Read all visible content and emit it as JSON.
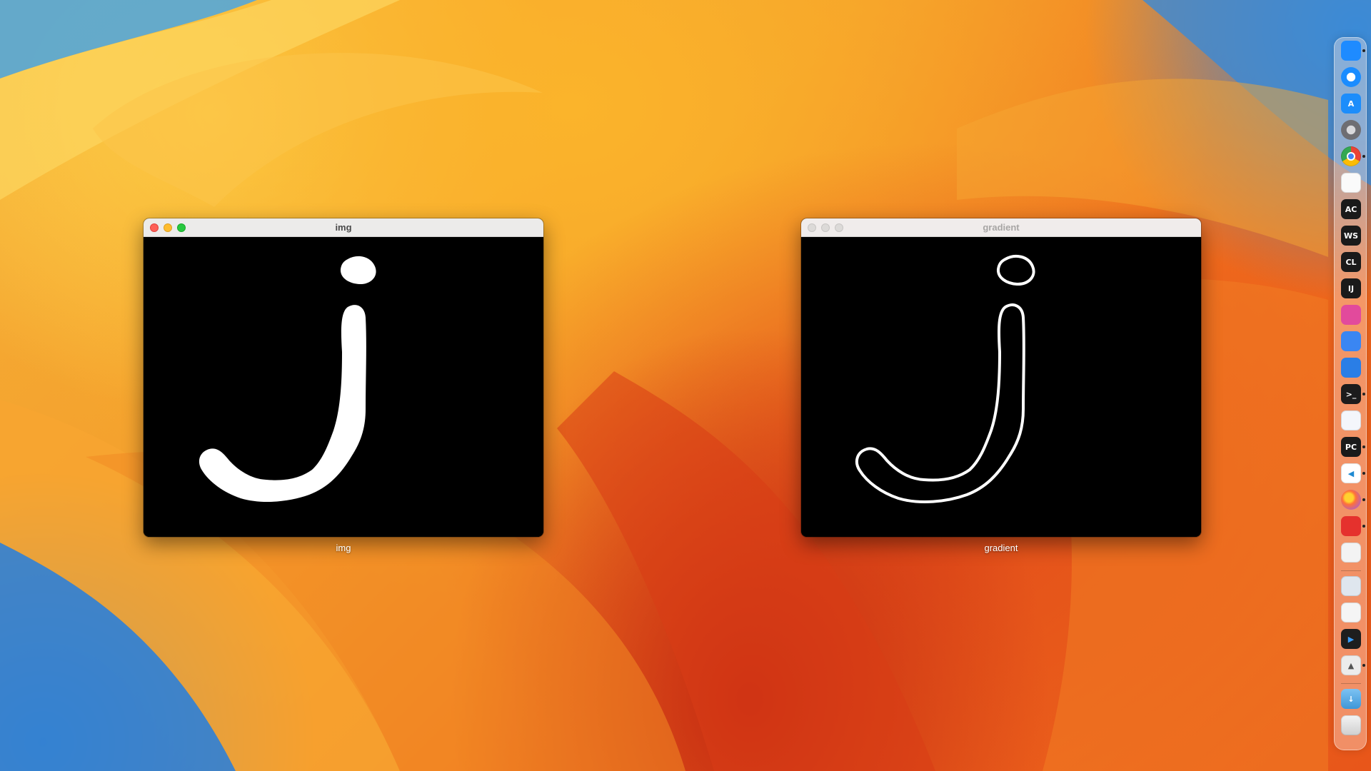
{
  "windows": [
    {
      "id": "img",
      "title": "img",
      "label": "img",
      "active": true
    },
    {
      "id": "gradient",
      "title": "gradient",
      "label": "gradient",
      "active": false
    }
  ],
  "dock": {
    "items": [
      {
        "name": "finder",
        "icon": "finder-icon",
        "color": "#1e8bff",
        "glyph": "",
        "running": true
      },
      {
        "name": "safari",
        "icon": "safari-icon",
        "color": "#1a8cff",
        "glyph": "",
        "running": false
      },
      {
        "name": "app-store",
        "icon": "app-store-icon",
        "color": "#1c8dfb",
        "glyph": "A",
        "running": false
      },
      {
        "name": "system-settings",
        "icon": "gear-icon",
        "color": "#8e8e93",
        "glyph": "",
        "running": false
      },
      {
        "name": "chrome",
        "icon": "chrome-icon",
        "color": "#ffffff",
        "glyph": "",
        "running": true
      },
      {
        "name": "notes",
        "icon": "notes-icon",
        "color": "#fafafa",
        "glyph": "",
        "running": false
      },
      {
        "name": "appcode",
        "icon": "appcode-icon",
        "color": "#1a1a1a",
        "glyph": "AC",
        "running": false
      },
      {
        "name": "webstorm",
        "icon": "webstorm-icon",
        "color": "#1a1a1a",
        "glyph": "WS",
        "running": false
      },
      {
        "name": "clion",
        "icon": "clion-icon",
        "color": "#1a1a1a",
        "glyph": "CL",
        "running": false
      },
      {
        "name": "intellij",
        "icon": "intellij-icon",
        "color": "#1a1a1a",
        "glyph": "IJ",
        "running": false
      },
      {
        "name": "cleanmymac",
        "icon": "cleanmymac-icon",
        "color": "#e24a9c",
        "glyph": "",
        "running": false
      },
      {
        "name": "xcode",
        "icon": "xcode-icon",
        "color": "#3a86f2",
        "glyph": "",
        "running": false
      },
      {
        "name": "mountain-app",
        "icon": "mountain-icon",
        "color": "#2a7ee6",
        "glyph": "",
        "running": false
      },
      {
        "name": "terminal",
        "icon": "terminal-icon",
        "color": "#1c1c1c",
        "glyph": ">_",
        "running": true
      },
      {
        "name": "1password",
        "icon": "1password-icon",
        "color": "#f4f6fb",
        "glyph": "",
        "running": false
      },
      {
        "name": "pycharm",
        "icon": "pycharm-icon",
        "color": "#1a1a1a",
        "glyph": "PC",
        "running": true
      },
      {
        "name": "vscode",
        "icon": "vscode-icon",
        "color": "#ffffff",
        "glyph": "",
        "running": true
      },
      {
        "name": "firefox",
        "icon": "firefox-icon",
        "color": "#ff7139",
        "glyph": "",
        "running": true
      },
      {
        "name": "screen-recorder",
        "icon": "recorder-icon",
        "color": "#e5312d",
        "glyph": "",
        "running": true
      },
      {
        "name": "launchpad",
        "icon": "launchpad-icon",
        "color": "#f3f3f3",
        "glyph": "",
        "running": false
      },
      {
        "name": "image-preview",
        "icon": "preview-icon",
        "color": "#dfe6ee",
        "glyph": "",
        "running": false
      },
      {
        "name": "photo-app",
        "icon": "photos-icon",
        "color": "#f5f5f5",
        "glyph": "",
        "running": false
      },
      {
        "name": "media-player",
        "icon": "play-icon",
        "color": "#1e1e1e",
        "glyph": "",
        "running": false
      },
      {
        "name": "python-launcher",
        "icon": "rocket-icon",
        "color": "#ececec",
        "glyph": "",
        "running": true
      },
      {
        "name": "downloads-folder",
        "icon": "folder-icon",
        "color": "#5aaee8",
        "glyph": "",
        "running": false
      },
      {
        "name": "trash",
        "icon": "trash-icon",
        "color": "#e8e8e8",
        "glyph": "",
        "running": false
      }
    ]
  }
}
